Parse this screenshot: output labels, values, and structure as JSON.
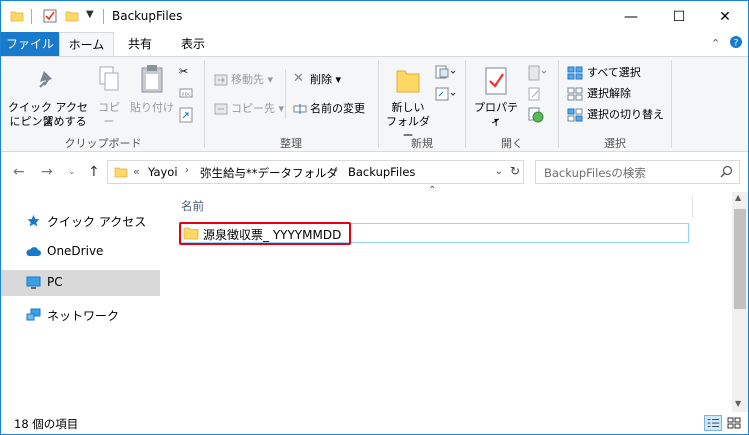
{
  "window": {
    "title": "BackupFiles",
    "minimize": "—",
    "maximize": "☐",
    "close": "✕"
  },
  "tabs": {
    "file": "ファイル",
    "home": "ホーム",
    "share": "共有",
    "view": "表示"
  },
  "ribbon": {
    "clipboard": {
      "pin": "クイック アクセス\nにピン留めする",
      "pin_line1": "クイック アクセス",
      "pin_line2": "にピン留めする",
      "copy": "コピー",
      "paste": "貼り付け",
      "group": "クリップボード"
    },
    "organize": {
      "move_to": "移動先 ▾",
      "copy_to": "コピー先 ▾",
      "delete": "削除 ▾",
      "rename": "名前の変更",
      "group": "整理"
    },
    "new": {
      "new_folder_line1": "新しい",
      "new_folder_line2": "フォルダー",
      "group": "新規"
    },
    "open": {
      "properties": "プロパティ",
      "group": "開く"
    },
    "select": {
      "select_all": "すべて選択",
      "select_none": "選択解除",
      "invert": "選択の切り替え",
      "group": "選択"
    }
  },
  "address": {
    "overflow": "«",
    "crumbs": [
      "Yayoi",
      "弥生給与**データフォルダ",
      "BackupFiles"
    ],
    "search_placeholder": "BackupFilesの検索"
  },
  "navigation": {
    "items": [
      {
        "label": "クイック アクセス",
        "icon": "star-icon"
      },
      {
        "label": "OneDrive",
        "icon": "cloud-icon"
      },
      {
        "label": "PC",
        "icon": "monitor-icon"
      },
      {
        "label": "ネットワーク",
        "icon": "network-icon"
      }
    ]
  },
  "content": {
    "column_name": "名前",
    "files": [
      {
        "name": "源泉徴収票_ YYYYMMDD",
        "type": "folder"
      }
    ]
  },
  "status": {
    "item_count": "18 個の項目"
  },
  "colors": {
    "accent": "#1979ca",
    "highlight_border": "#e60012",
    "folder": "#ffd765"
  }
}
